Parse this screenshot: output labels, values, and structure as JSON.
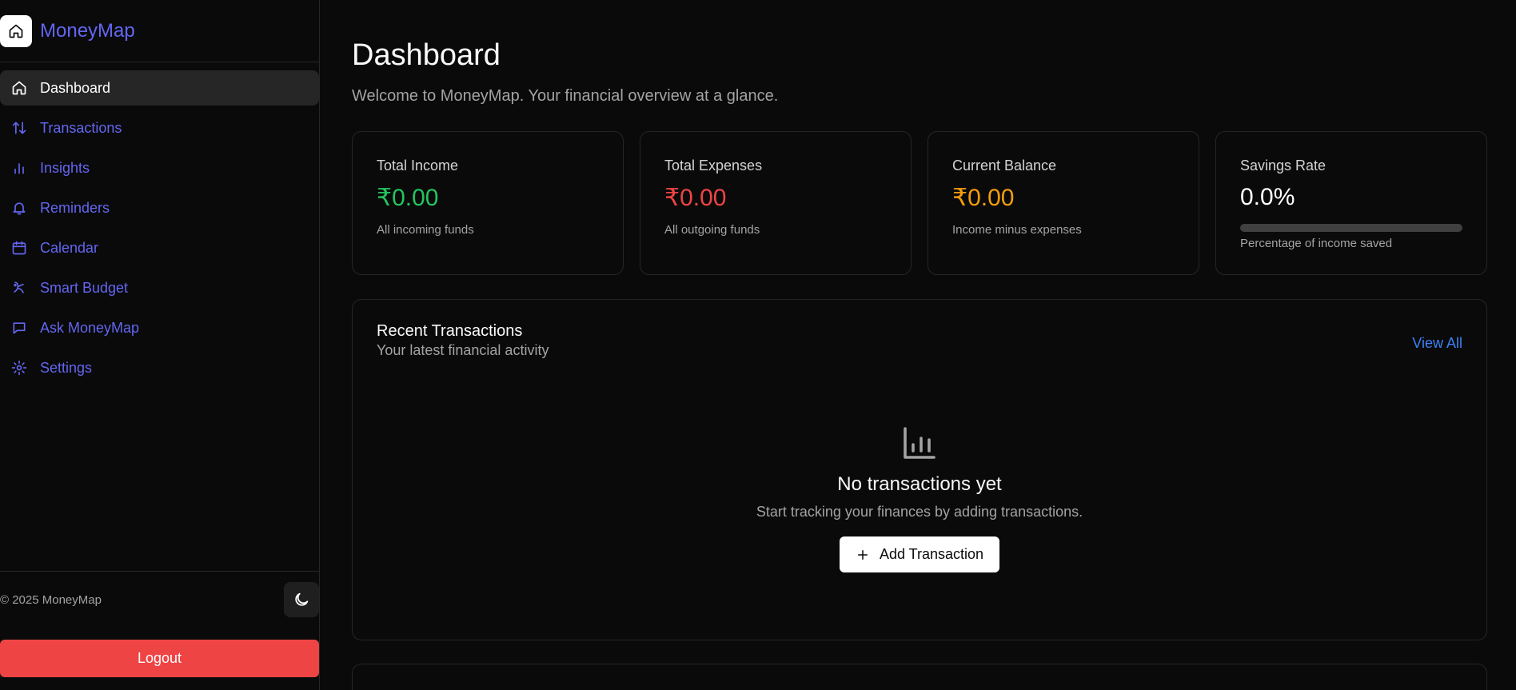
{
  "brand": {
    "name": "MoneyMap",
    "icon": "home-icon"
  },
  "sidebar": {
    "items": [
      {
        "label": "Dashboard",
        "icon": "home-icon",
        "active": true
      },
      {
        "label": "Transactions",
        "icon": "arrows-updown-icon"
      },
      {
        "label": "Insights",
        "icon": "bar-chart-icon"
      },
      {
        "label": "Reminders",
        "icon": "bell-icon"
      },
      {
        "label": "Calendar",
        "icon": "calendar-icon"
      },
      {
        "label": "Smart Budget",
        "icon": "piggy-bank-icon"
      },
      {
        "label": "Ask MoneyMap",
        "icon": "message-icon"
      },
      {
        "label": "Settings",
        "icon": "gear-icon"
      }
    ],
    "copyright": "© 2025 MoneyMap",
    "theme_icon": "moon-icon",
    "logout_label": "Logout"
  },
  "main": {
    "title": "Dashboard",
    "subtitle": "Welcome to MoneyMap. Your financial overview at a glance.",
    "stats": [
      {
        "label": "Total Income",
        "value": "₹0.00",
        "desc": "All incoming funds",
        "color": "#22c55e"
      },
      {
        "label": "Total Expenses",
        "value": "₹0.00",
        "desc": "All outgoing funds",
        "color": "#ef4444"
      },
      {
        "label": "Current Balance",
        "value": "₹0.00",
        "desc": "Income minus expenses",
        "color": "#f59e0b"
      },
      {
        "label": "Savings Rate",
        "value": "0.0%",
        "desc": "Percentage of income saved",
        "color": "#ffffff",
        "progress": 0
      }
    ],
    "recent": {
      "title": "Recent Transactions",
      "subtitle": "Your latest financial activity",
      "view_all": "View All",
      "empty_icon": "bar-chart-icon",
      "empty_title": "No transactions yet",
      "empty_subtitle": "Start tracking your finances by adding transactions.",
      "add_label": "Add Transaction"
    }
  },
  "colors": {
    "accent": "#6366f1",
    "link": "#3b82f6",
    "danger": "#ef4444"
  }
}
